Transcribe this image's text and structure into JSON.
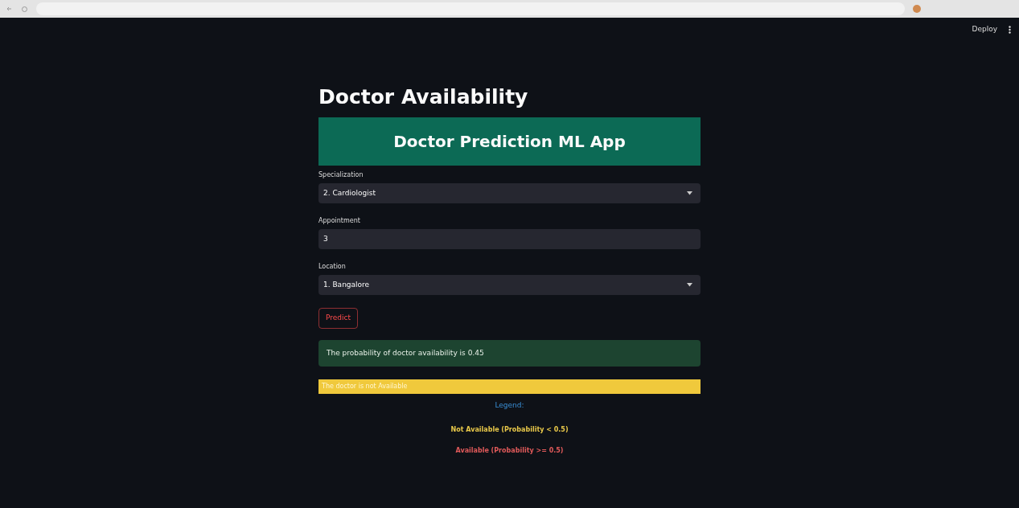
{
  "toolbar": {
    "deploy": "Deploy"
  },
  "title": "Doctor Availability",
  "banner": "Doctor Prediction ML App",
  "fields": [
    {
      "kind": "select",
      "label": "Specialization",
      "value": "2. Cardiologist"
    },
    {
      "kind": "number",
      "label": "Appointment",
      "value": "3"
    },
    {
      "kind": "select",
      "label": "Location",
      "value": "1. Bangalore"
    }
  ],
  "predict_button": "Predict",
  "result": "The probability of doctor availability is 0.45",
  "warning": "The doctor is not Available",
  "legend": {
    "title": "Legend:",
    "items": [
      {
        "label": "Not Available (Probability < 0.5)",
        "color": "#e8c84a"
      },
      {
        "label": "Available (Probability >= 0.5)",
        "color": "#e05a5a"
      }
    ]
  }
}
